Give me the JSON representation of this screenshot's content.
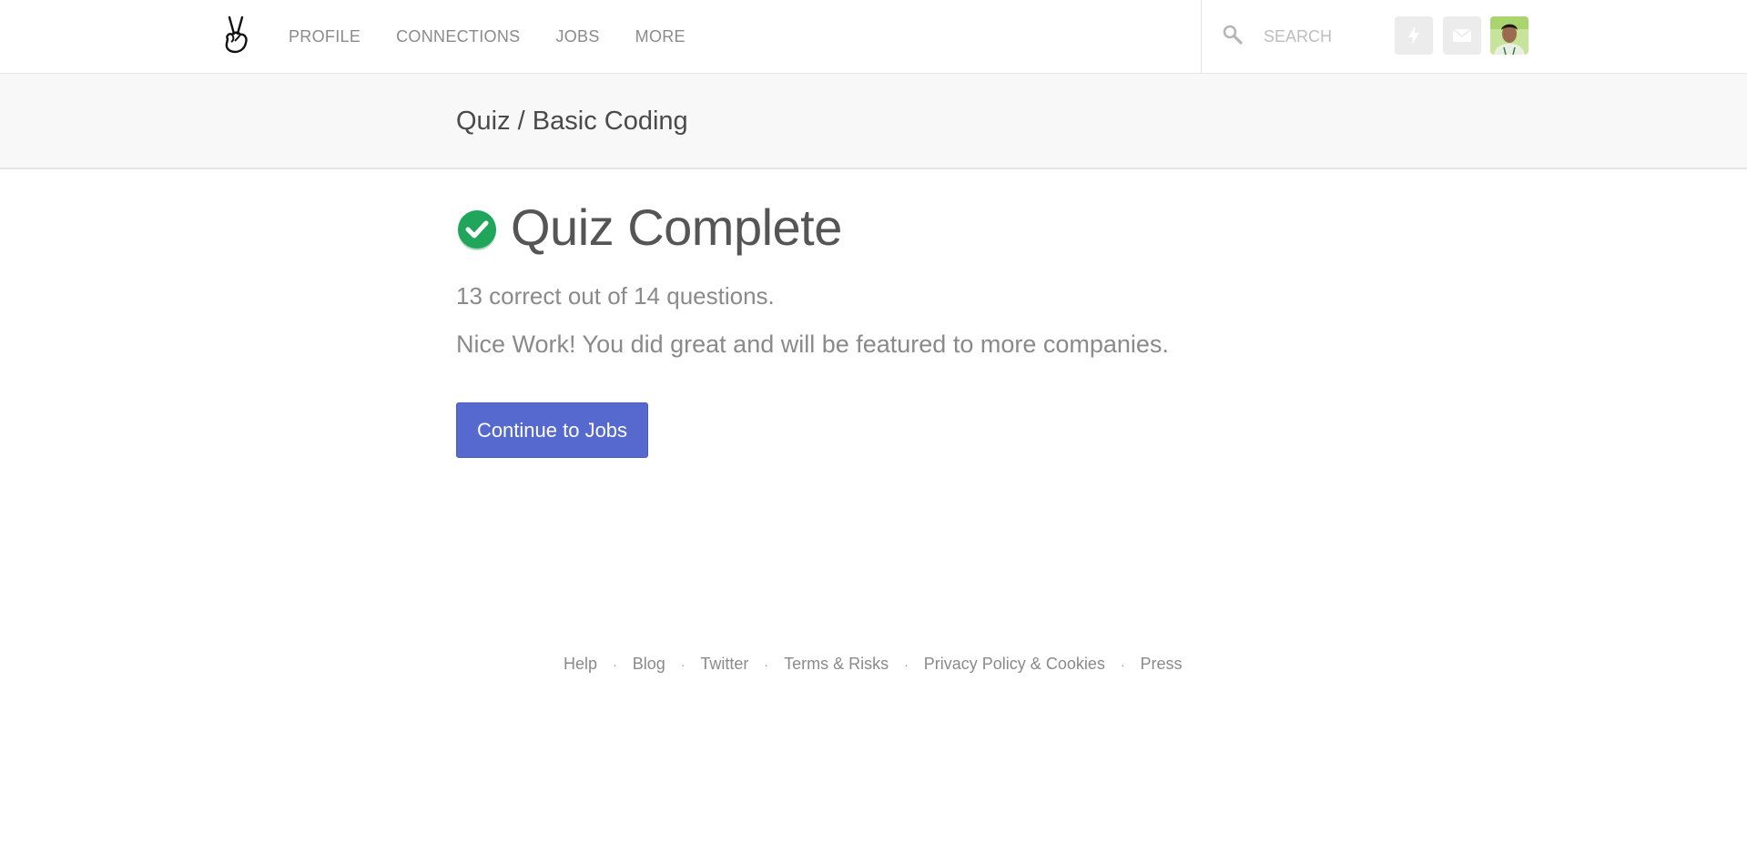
{
  "nav": {
    "links": [
      "PROFILE",
      "CONNECTIONS",
      "JOBS",
      "MORE"
    ],
    "search_placeholder": "SEARCH",
    "icons": {
      "logo": "victory-hand-logo",
      "search": "search-icon",
      "bolt": "bolt-icon",
      "mail": "mail-icon"
    }
  },
  "subheader": {
    "breadcrumb": "Quiz / Basic Coding"
  },
  "main": {
    "title": "Quiz Complete",
    "score": "13 correct out of 14 questions.",
    "praise": "Nice Work! You did great and will be featured to more companies.",
    "continue_label": "Continue to Jobs"
  },
  "footer": {
    "links": [
      "Help",
      "Blog",
      "Twitter",
      "Terms & Risks",
      "Privacy Policy & Cookies",
      "Press"
    ],
    "separator": "·"
  },
  "colors": {
    "accent": "#5569cf",
    "success": "#1fa65a",
    "muted_text": "#8a8a8a"
  }
}
